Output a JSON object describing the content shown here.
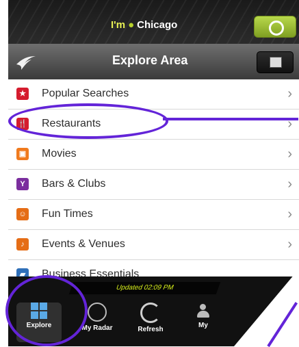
{
  "status": {
    "location_prefix": "I'm",
    "location_city": "Chicago"
  },
  "header": {
    "title": "Explore Area"
  },
  "menu": {
    "items": [
      {
        "label": "Popular Searches"
      },
      {
        "label": "Restaurants"
      },
      {
        "label": "Movies"
      },
      {
        "label": "Bars & Clubs"
      },
      {
        "label": "Fun Times"
      },
      {
        "label": "Events & Venues"
      },
      {
        "label": "Business Essentials"
      }
    ]
  },
  "footer": {
    "update_text": "Updated 02:09 PM",
    "tabs": [
      {
        "label": "Explore"
      },
      {
        "label": "My Radar"
      },
      {
        "label": "Refresh"
      },
      {
        "label": "My"
      }
    ]
  },
  "colors": {
    "annotation": "#6324d8",
    "accent_green": "#9bbe33"
  },
  "icons": {
    "status_locate": "locate-icon",
    "nav_logo": "bird-icon",
    "nav_action": "edit-icon"
  }
}
